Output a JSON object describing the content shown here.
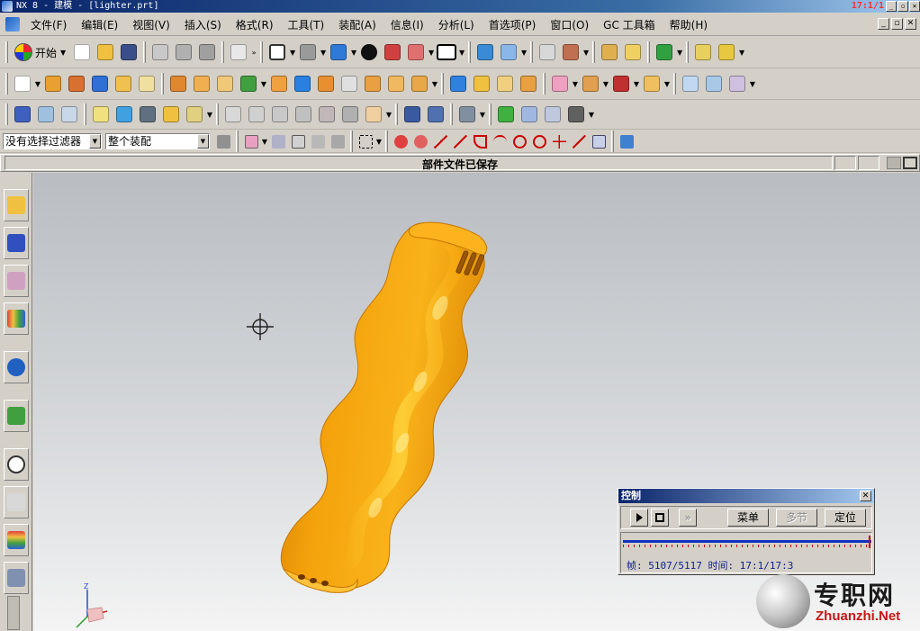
{
  "window": {
    "title": "NX 8 - 建模 - [lighter.prt]",
    "clock": "17:1/1"
  },
  "menu": [
    "文件(F)",
    "编辑(E)",
    "视图(V)",
    "插入(S)",
    "格式(R)",
    "工具(T)",
    "装配(A)",
    "信息(I)",
    "分析(L)",
    "首选项(P)",
    "窗口(O)",
    "GC 工具箱",
    "帮助(H)"
  ],
  "toolbar": {
    "start_label": "开始"
  },
  "selection": {
    "filter": "没有选择过滤器",
    "scope": "整个装配"
  },
  "status": {
    "message": "部件文件已保存"
  },
  "control_dialog": {
    "title": "控制",
    "menu_button": "菜单",
    "multi_button": "多节",
    "locate_button": "定位",
    "frame_text": "帧: 5107/5117 时间: 17:1/17:3",
    "progress": 0.998
  },
  "watermark": {
    "cn": "专职网",
    "en": "Zhuanzhi.Net"
  },
  "triad": {
    "z_label": "Z"
  },
  "colors": {
    "model": "#f4a30c",
    "model_highlight": "#ffd23a",
    "titlebar": "#0a246a",
    "slider": "#1030c0"
  },
  "icons": {
    "tb1": [
      "new-file-icon",
      "open-folder-icon",
      "save-icon",
      "cut-icon",
      "copy-icon",
      "paste-icon",
      "undo-icon",
      "fit-view-icon",
      "shaded-view-icon",
      "cube-view-icon",
      "display-mode-icon",
      "section-view-icon",
      "render-style-icon",
      "layer-icon",
      "wcs-icon",
      "assembly-icon",
      "component-icon",
      "measure-icon",
      "analysis-icon"
    ],
    "tb2": [
      "sketch-icon",
      "extrude-icon",
      "revolve-icon",
      "block-icon",
      "cylinder-icon",
      "hole-icon",
      "edge-blend-icon",
      "chamfer-icon",
      "shell-icon",
      "draft-icon",
      "trim-icon",
      "boolean-icon",
      "pattern-icon",
      "mirror-icon",
      "offset-face-icon",
      "thicken-icon",
      "sweep-icon",
      "surface-icon",
      "through-curves-icon",
      "face-blend-icon",
      "sew-icon",
      "move-face-icon",
      "replace-face-icon",
      "delete-face-icon",
      "synchronous-icon",
      "studio-surface-icon",
      "transform-icon"
    ],
    "tb3": [
      "datum-csys-icon",
      "layer-settings-icon",
      "move-layer-icon",
      "note-icon",
      "wave-icon",
      "hammer-icon",
      "inspect-icon",
      "drafting-icon",
      "curve-g0-icon",
      "curve-g1-icon",
      "curve-g2-icon",
      "curve-g3-icon",
      "deviation-icon",
      "info-icon",
      "spring-icon",
      "gear-icon",
      "checkmate-icon",
      "table-icon",
      "grid-icon",
      "csys-icon"
    ],
    "tb4": [
      "snap-icon",
      "selection-icon",
      "undo-select-icon",
      "solid-icon",
      "point-icon",
      "lasso-icon",
      "rectangle-select-icon",
      "snap-point-icon",
      "end-point-icon",
      "mid-point-icon",
      "control-point-icon",
      "intersection-icon",
      "arc-center-icon",
      "quadrant-icon",
      "existing-point-icon",
      "curve-point-icon",
      "face-point-icon",
      "bounding-box-icon"
    ],
    "resources": [
      "assembly-navigator-icon",
      "constraint-navigator-icon",
      "part-navigator-icon",
      "reuse-library-icon",
      "hd3d-icon",
      "web-browser-icon",
      "history-icon",
      "system-materials-icon",
      "process-studio-icon",
      "roles-icon"
    ]
  }
}
